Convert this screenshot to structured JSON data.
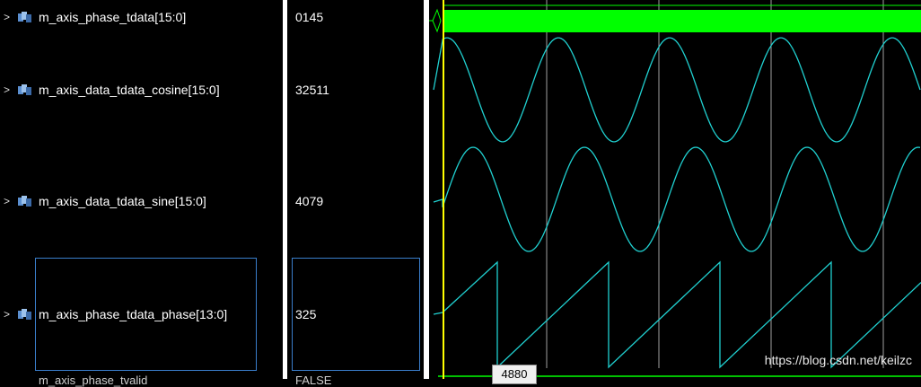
{
  "signals": [
    {
      "name": "m_axis_phase_tdata[15:0]",
      "value": "0145",
      "icon": "bus-signal-icon"
    },
    {
      "name": "m_axis_data_tdata_cosine[15:0]",
      "value": "32511",
      "icon": "bus-signal-icon"
    },
    {
      "name": "m_axis_data_tdata_sine[15:0]",
      "value": "4079",
      "icon": "bus-signal-icon"
    },
    {
      "name": "m_axis_phase_tdata_phase[13:0]",
      "value": "325",
      "icon": "bus-signal-icon"
    }
  ],
  "expander_glyph": ">",
  "partial_row": {
    "name": "m_axis_phase_tvalid",
    "value": "FALSE"
  },
  "cursor_label": "4880",
  "watermark": "https://blog.csdn.net/keilzc",
  "colors": {
    "background": "#000000",
    "separator": "#ffffff",
    "bus_green": "#00ff00",
    "analog_wave": "#20d0d0",
    "cursor": "#ffff00",
    "gridline": "#c8c8c8",
    "selection": "#3a7ecb"
  }
}
